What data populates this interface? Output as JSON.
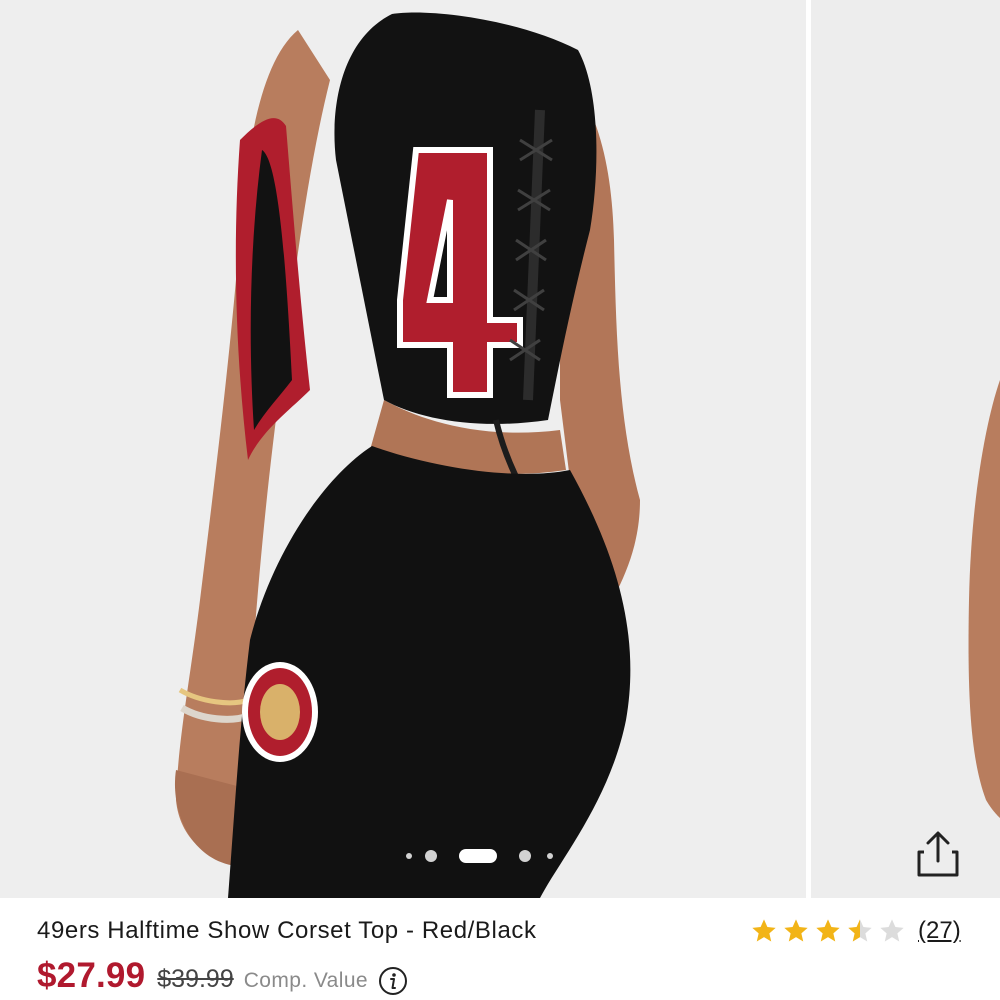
{
  "gallery": {
    "dots": [
      "small",
      "medium",
      "active",
      "medium",
      "small"
    ],
    "share_icon": "share-icon",
    "photo_colors": {
      "background": "#eeeeee",
      "skin": "#b57b5d",
      "jersey_black": "#121212",
      "jersey_red": "#b01e2d"
    }
  },
  "product": {
    "title": "49ers Halftime Show Corset Top - Red/Black",
    "rating": {
      "value": 3.5,
      "max": 5,
      "review_count_label": "(27)",
      "star_color": "#f2b417",
      "empty_star_color": "#dcdcdc"
    },
    "price": {
      "sale": "$27.99",
      "original": "$39.99",
      "comp_label": "Comp. Value",
      "sale_color": "#b0192e"
    },
    "info_icon": "info-icon"
  }
}
